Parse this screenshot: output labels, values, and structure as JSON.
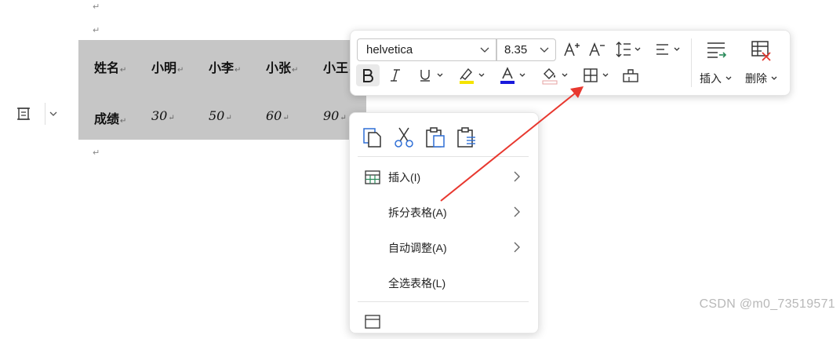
{
  "document": {
    "para_mark": "↵"
  },
  "table": {
    "rows": [
      {
        "header": "姓名",
        "cells": [
          "小明",
          "小李",
          "小张",
          "小王"
        ]
      },
      {
        "header": "成绩",
        "cells": [
          "30",
          "50",
          "60",
          "90"
        ]
      }
    ]
  },
  "toolbar": {
    "font_name": "helvetica",
    "font_size": "8.35",
    "insert_label": "插入",
    "delete_label": "删除",
    "icons": [
      "increase-font-icon",
      "decrease-font-icon",
      "line-spacing-icon",
      "align-icon",
      "bold-icon",
      "italic-icon",
      "underline-icon",
      "highlight-icon",
      "font-color-icon",
      "shading-icon",
      "borders-icon",
      "clear-format-icon",
      "insert-row-icon",
      "delete-table-icon"
    ],
    "colors": {
      "highlight": "#f5e400",
      "font_color": "#1a1adc",
      "shading": "#e6a0a0"
    }
  },
  "context_menu": {
    "top_icons": [
      "copy-icon",
      "cut-icon",
      "paste-icon",
      "paste-special-icon"
    ],
    "items": [
      {
        "label": "插入(I)",
        "has_submenu": true
      },
      {
        "label": "拆分表格(A)",
        "has_submenu": true
      },
      {
        "label": "自动调整(A)",
        "has_submenu": true
      },
      {
        "label": "全选表格(L)",
        "has_submenu": false
      }
    ]
  },
  "annotation": {
    "arrow_color": "#e8382f"
  },
  "watermark": "CSDN @m0_73519571"
}
